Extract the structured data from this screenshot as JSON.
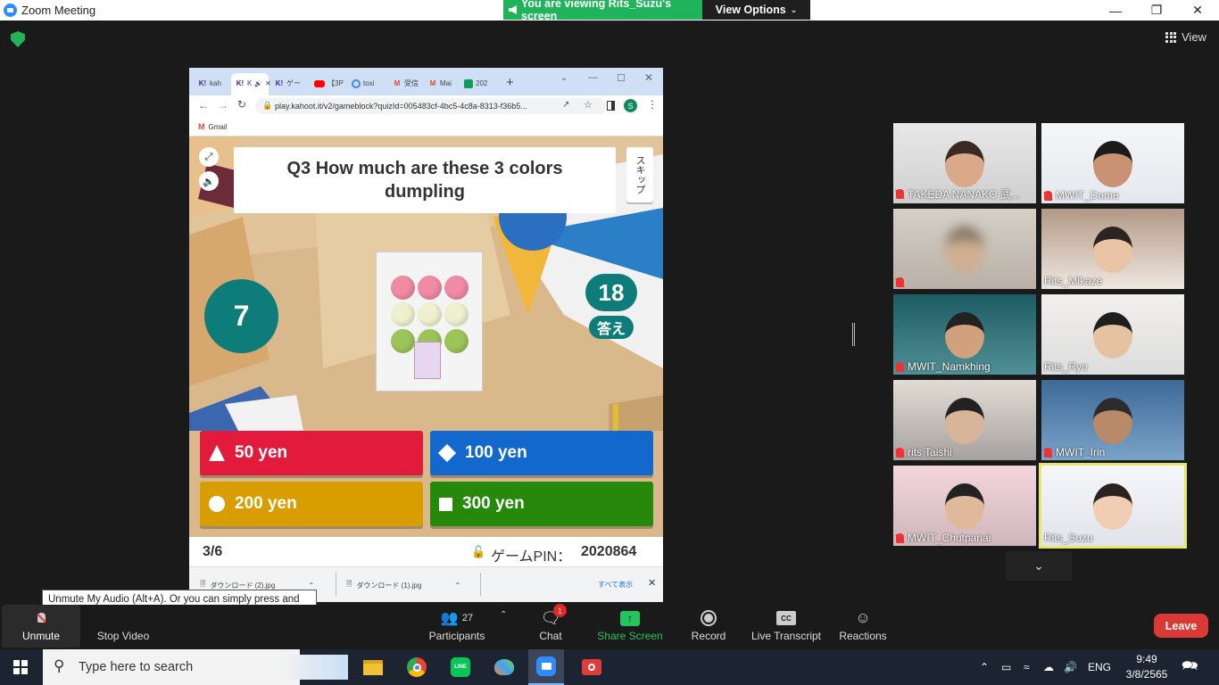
{
  "window": {
    "title": "Zoom Meeting"
  },
  "share_banner": {
    "viewing_text": "You are viewing Rits_Suzu's screen",
    "view_options": "View Options"
  },
  "view_button": "View",
  "browser": {
    "tabs": [
      {
        "label": "kah",
        "icon": "K!",
        "color": "#46178f"
      },
      {
        "label": "K",
        "icon": "K!",
        "color": "#46178f"
      },
      {
        "label": "ゲー",
        "icon": "K!",
        "color": "#46178f"
      },
      {
        "label": "【3P",
        "icon": "youtube",
        "color": "#ff0000"
      },
      {
        "label": "toxi",
        "icon": "google",
        "color": "#4285f4"
      },
      {
        "label": "受信",
        "icon": "gmail",
        "color": "#ea4335"
      },
      {
        "label": "Mai",
        "icon": "gmail",
        "color": "#ea4335"
      },
      {
        "label": "202",
        "icon": "sheets",
        "color": "#0f9d58"
      }
    ],
    "url": "play.kahoot.it/v2/gameblock?quizId=005483cf-4bc5-4c8a-8313-f36b5...",
    "bookmark": "Gmail",
    "profile_initial": "S",
    "downloads": [
      {
        "name": "ダウンロード (2).jpg"
      },
      {
        "name": "ダウンロード (1).jpg"
      }
    ],
    "show_all": "すべて表示"
  },
  "kahoot": {
    "question": "Q3 How much are these 3 colors dumpling",
    "skip": "スキップ",
    "timer": "7",
    "answers_count": "18",
    "answers_label": "答え",
    "options": [
      {
        "label": "50 yen",
        "shape": "triangle",
        "color": "#e21b3c"
      },
      {
        "label": "100 yen",
        "shape": "diamond",
        "color": "#1368ce"
      },
      {
        "label": "200 yen",
        "shape": "circle",
        "color": "#d89e00"
      },
      {
        "label": "300 yen",
        "shape": "square",
        "color": "#26890c"
      }
    ],
    "progress": "3/6",
    "pin_label": "ゲームPIN：",
    "pin": "2020864"
  },
  "participants_gallery": [
    {
      "name": "TAKEDA NANAKO 武...",
      "muted": true
    },
    {
      "name": "MWIT_Dome",
      "muted": true
    },
    {
      "name": "",
      "muted": true
    },
    {
      "name": "Rits_Mikaze",
      "muted": false
    },
    {
      "name": "MWIT_Namkhing",
      "muted": true
    },
    {
      "name": "Rits_Ryo",
      "muted": false
    },
    {
      "name": "rits Taishi",
      "muted": true
    },
    {
      "name": "MWIT_Irin",
      "muted": true
    },
    {
      "name": "MWIT_Chutpanai",
      "muted": true
    },
    {
      "name": "Rits_Suzu",
      "muted": false
    }
  ],
  "toolbar": {
    "unmute": "Unmute",
    "stop_video": "Stop Video",
    "participants": "Participants",
    "participants_count": "27",
    "chat": "Chat",
    "chat_badge": "1",
    "share_screen": "Share Screen",
    "record": "Record",
    "live_transcript": "Live Transcript",
    "reactions": "Reactions",
    "leave": "Leave",
    "tooltip": "Unmute My Audio (Alt+A). Or you can simply press and hold the space bar to temporarily unmute."
  },
  "taskbar": {
    "search_placeholder": "Type here to search",
    "language": "ENG",
    "time": "9:49",
    "date": "3/8/2565"
  },
  "colors": {
    "zoom_blue": "#2d8cff",
    "share_green": "#1fb35b",
    "leave_red": "#d93a35",
    "kahoot_teal": "#0e7d7a",
    "active_speaker": "#e6e86a"
  }
}
